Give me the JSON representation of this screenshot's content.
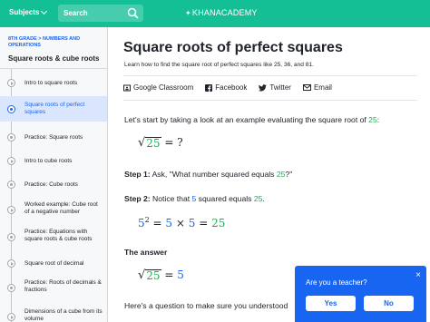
{
  "header": {
    "subjects_label": "Subjects",
    "search_placeholder": "Search",
    "logo_text": "KHANACADEMY",
    "brand_color": "#14bf96"
  },
  "sidebar": {
    "breadcrumb": "8TH GRADE > NUMBERS AND OPERATIONS",
    "unit_title": "Square roots & cube roots",
    "items": [
      {
        "label": "Intro to square roots",
        "type": "video",
        "active": false
      },
      {
        "label": "Square roots of perfect squares",
        "type": "article",
        "active": true
      },
      {
        "label": "Practice: Square roots",
        "type": "exercise",
        "active": false
      },
      {
        "label": "Intro to cube roots",
        "type": "video",
        "active": false
      },
      {
        "label": "Practice: Cube roots",
        "type": "exercise",
        "active": false
      },
      {
        "label": "Worked example: Cube root of a negative number",
        "type": "video",
        "active": false
      },
      {
        "label": "Practice: Equations with square roots & cube roots",
        "type": "exercise",
        "active": false
      },
      {
        "label": "Square root of decimal",
        "type": "video",
        "active": false
      },
      {
        "label": "Practice: Roots of decimals & fractions",
        "type": "exercise",
        "active": false
      },
      {
        "label": "Dimensions of a cube from its volume",
        "type": "video",
        "active": false
      }
    ]
  },
  "article": {
    "title": "Square roots of perfect squares",
    "description": "Learn how to find the square root of perfect squares like 25, 36, and 81.",
    "share": {
      "classroom": "Google Classroom",
      "facebook": "Facebook",
      "twitter": "Twitter",
      "email": "Email"
    },
    "intro_text": "Let's start by taking a look at an example evaluating the square root of ",
    "intro_number": "25",
    "intro_end": ":",
    "eq1_radicand": "25",
    "eq1_rest": " = ?",
    "step1_label": "Step 1:",
    "step1_text": " Ask, \"What number squared equals ",
    "step1_number": "25",
    "step1_end": "?\"",
    "step2_label": "Step 2:",
    "step2_text": " Notice that ",
    "step2_five": "5",
    "step2_mid": " squared equals ",
    "step2_number": "25",
    "step2_end": ".",
    "eq2_base": "5",
    "eq2_exp": "2",
    "eq2_eq": " = ",
    "eq2_a": "5",
    "eq2_times": " × ",
    "eq2_b": "5",
    "eq2_eq2": " = ",
    "eq2_result": "25",
    "answer_heading": "The answer",
    "eq3_radicand": "25",
    "eq3_eq": " = ",
    "eq3_result": "5",
    "question_text": "Here's a question to make sure you understood"
  },
  "teacher_popup": {
    "question": "Are you a teacher?",
    "yes": "Yes",
    "no": "No",
    "close_symbol": "×"
  }
}
